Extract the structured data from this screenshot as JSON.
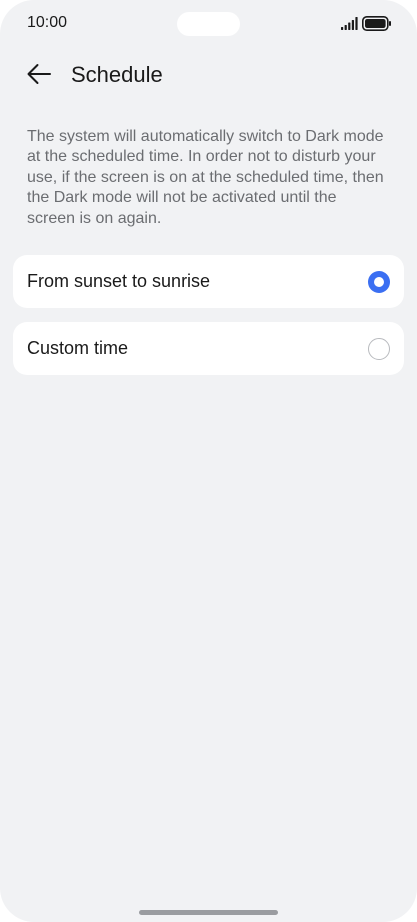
{
  "status_bar": {
    "time": "10:00",
    "signal_icon": "signal-bars-icon",
    "battery_icon": "battery-full-icon"
  },
  "header": {
    "back_icon": "arrow-left-icon",
    "title": "Schedule"
  },
  "description": "The system will automatically switch to Dark mode at the scheduled time. In order not to disturb your use, if the screen is on at the scheduled time, then the Dark mode will not be activated until the screen is on again.",
  "options": [
    {
      "label": "From sunset to sunrise",
      "selected": true
    },
    {
      "label": "Custom time",
      "selected": false
    }
  ],
  "colors": {
    "background": "#f1f2f4",
    "card": "#ffffff",
    "accent": "#3b6ff2",
    "text_primary": "#1a1a1a",
    "text_secondary": "#6b6d71"
  }
}
